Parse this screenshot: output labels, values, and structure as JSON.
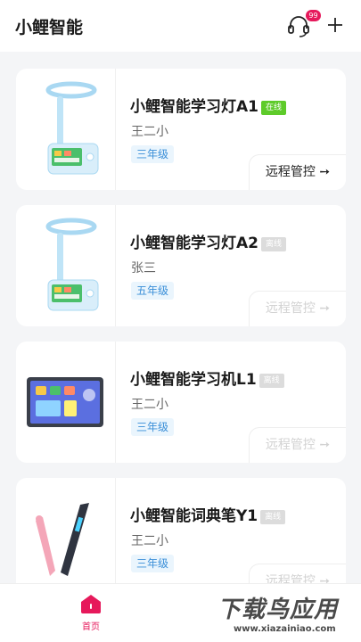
{
  "header": {
    "title": "小鲤智能",
    "support_badge": "99",
    "support_icon": "headset-icon",
    "add_icon": "plus-icon"
  },
  "devices": [
    {
      "name": "小鲤智能学习灯A1",
      "status": "在线",
      "owner": "王二小",
      "grade": "三年级",
      "action": "远程管控 ➙",
      "image": "study-lamp-image"
    },
    {
      "name": "小鲤智能学习灯A2",
      "status": "离线",
      "owner": "张三",
      "grade": "五年级",
      "action": "远程管控 ➙",
      "image": "study-lamp-image"
    },
    {
      "name": "小鲤智能学习机L1",
      "status": "离线",
      "owner": "王二小",
      "grade": "三年级",
      "action": "远程管控 ➙",
      "image": "tablet-image"
    },
    {
      "name": "小鲤智能词典笔Y1",
      "status": "离线",
      "owner": "王二小",
      "grade": "三年级",
      "action": "远程管控 ➙",
      "image": "dictionary-pen-image"
    }
  ],
  "tabbar": {
    "home_label": "首页",
    "home_icon": "home-icon"
  },
  "watermark": {
    "main": "下载鸟应用",
    "sub": "www.xiazainiao.com"
  },
  "colors": {
    "accent": "#e6195b",
    "online": "#5ecb2a",
    "offline": "#dcdcdc",
    "grade_bg": "#eaf5fd",
    "grade_text": "#3b8fd8"
  }
}
